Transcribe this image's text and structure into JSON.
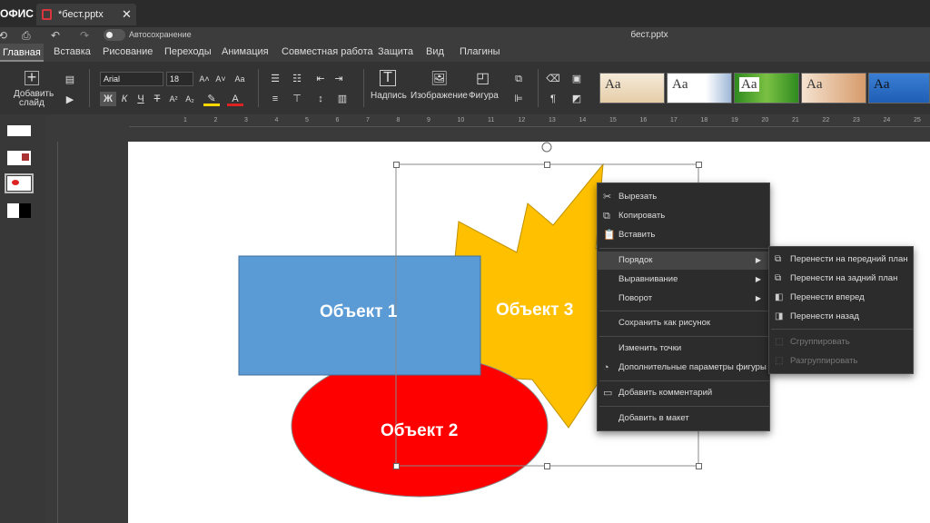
{
  "app": {
    "brand": "ОФИС",
    "file_tab": "*бест.pptx",
    "close": "✕",
    "doc_title": "бест.pptx"
  },
  "quick_access": {
    "autosave_label": "Автосохранение"
  },
  "menu": [
    "Главная",
    "Вставка",
    "Рисование",
    "Переходы",
    "Анимация",
    "Совместная работа",
    "Защита",
    "Вид",
    "Плагины"
  ],
  "ribbon": {
    "add_slide_line1": "Добавить",
    "add_slide_line2": "слайд",
    "font_name": "Arial",
    "font_size": "18",
    "caption": "Надпись",
    "image": "Изображение",
    "shape": "Фигура",
    "bold": "Ж",
    "italic": "К",
    "underline": "Ч",
    "strike": "Т",
    "theme_text": "Aa"
  },
  "ruler_numbers": [
    "1",
    "2",
    "3",
    "4",
    "5",
    "6",
    "7",
    "8",
    "9",
    "10",
    "11",
    "12",
    "13",
    "14",
    "15",
    "16",
    "17",
    "18",
    "19",
    "20",
    "21",
    "22",
    "23",
    "24",
    "25"
  ],
  "slide": {
    "obj1": "Объект 1",
    "obj2": "Объект 2",
    "obj3": "Объект 3"
  },
  "context_menu": {
    "cut": "Вырезать",
    "copy": "Копировать",
    "paste": "Вставить",
    "order": "Порядок",
    "align": "Выравнивание",
    "rotate": "Поворот",
    "save_as_image": "Сохранить как рисунок",
    "edit_points": "Изменить точки",
    "shape_settings": "Дополнительные параметры фигуры",
    "add_comment": "Добавить комментарий",
    "add_to_layout": "Добавить в макет"
  },
  "order_submenu": {
    "bring_front": "Перенести на передний план",
    "send_back": "Перенести на задний план",
    "bring_forward": "Перенести вперед",
    "send_backward": "Перенести назад",
    "group": "Сгруппировать",
    "ungroup": "Разгруппировать"
  },
  "colors": {
    "obj1": "#5b9bd5",
    "obj2": "#ff0000",
    "obj3": "#ffc000",
    "menu_bg": "#2c2c2c"
  }
}
